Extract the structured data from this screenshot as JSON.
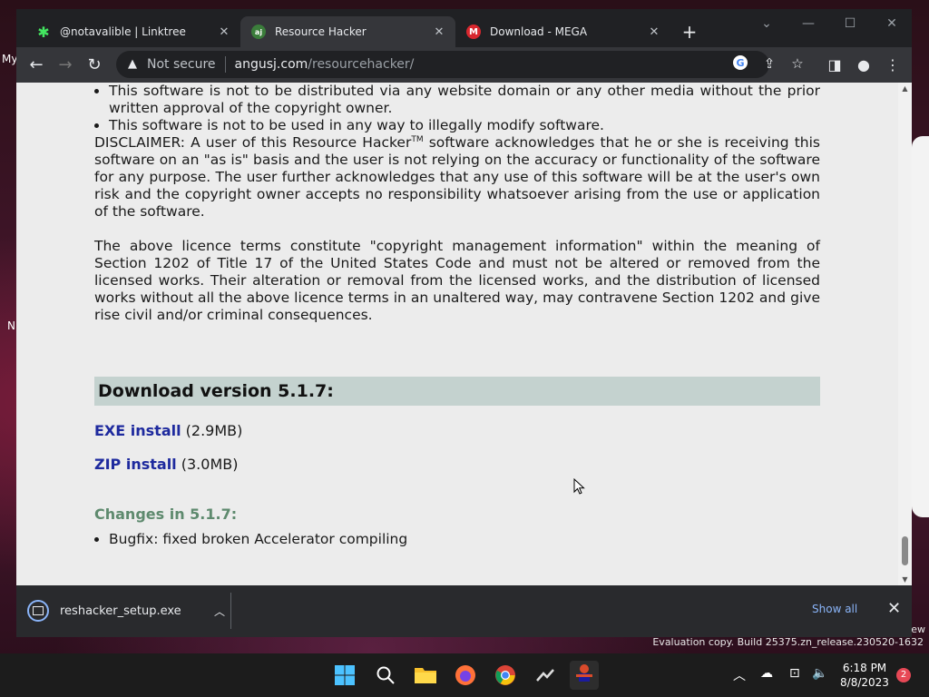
{
  "desktop": {
    "frag_my": "My",
    "frag_n": "N",
    "watermark_ew": "ew",
    "watermark": "Evaluation copy. Build 25375.zn_release.230520-1632"
  },
  "tabs": [
    {
      "title": "@notavalible | Linktree",
      "icon": "linktree-icon",
      "color": "#43e660"
    },
    {
      "title": "Resource Hacker",
      "icon": "rh-icon",
      "color": "#3b7d3b"
    },
    {
      "title": "Download - MEGA",
      "icon": "mega-icon",
      "color": "#d9272e"
    }
  ],
  "toolbar": {
    "not_secure": "Not secure",
    "domain": "angusj.com",
    "path": "/resourcehacker/"
  },
  "page": {
    "bullet1": "This software is not to be distributed via any website domain or any other media without the prior written approval of the copyright owner.",
    "bullet2": "This software is not to be used in any way to illegally modify software.",
    "disclaimer_a": "DISCLAIMER: A user of this Resource Hacker",
    "tm": "TM",
    "disclaimer_b": " software acknowledges that he or she is receiving this software on an \"as is\" basis and the user is not relying on the accuracy or functionality of the software for any purpose. The user further acknowledges that any use of this software will be at the user's own risk and the copyright owner accepts no responsibility whatsoever arising from the use or application of the software.",
    "licence": "The above licence terms constitute \"copyright management information\" within the meaning of Section 1202 of Title 17 of the United States Code and must not be altered or removed from the licensed works. Their alteration or removal from the licensed works, and the distribution of licensed works without all the above licence terms in an unaltered way, may contravene Section 1202 and give rise civil and/or criminal consequences.",
    "download_heading": "Download version 5.1.7:",
    "exe_link": "EXE install",
    "exe_size": " (2.9MB)",
    "zip_link": "ZIP install",
    "zip_size": " (3.0MB)",
    "changes_heading": "Changes in 5.1.7:",
    "change1": "Bugfix: fixed broken Accelerator compiling"
  },
  "download_bar": {
    "filename": "reshacker_setup.exe",
    "show_all": "Show all"
  },
  "taskbar": {
    "time": "6:18 PM",
    "date": "8/8/2023",
    "notification_count": "2"
  },
  "colors": {
    "link": "#1e2a9e",
    "heading_bg": "#c4d2cf",
    "changes_heading": "#5e8a6e"
  }
}
